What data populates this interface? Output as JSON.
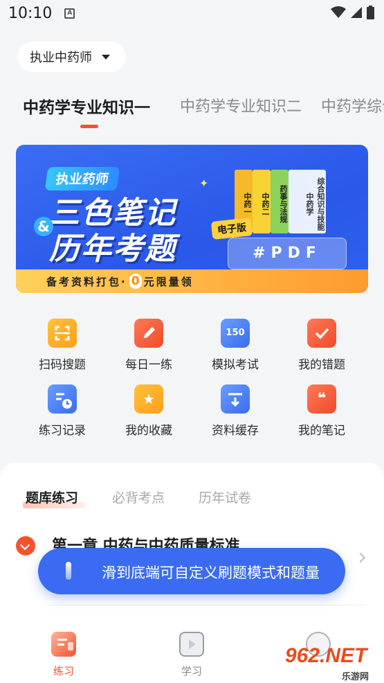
{
  "status_bar": {
    "time": "10:10",
    "notification_letter": "A"
  },
  "cert_selector": {
    "label": "执业中药师"
  },
  "subject_tabs": [
    {
      "label": "中药学专业知识一",
      "active": true
    },
    {
      "label": "中药学专业知识二",
      "active": false
    },
    {
      "label": "中药学综合",
      "active": false
    }
  ],
  "banner": {
    "badge": "执业药师",
    "title_line1": "三色笔记",
    "amp": "&",
    "title_line2": "历年考题",
    "ebook_tag": "电子版",
    "pdf_label": "#PDF",
    "strip_prefix": "备考资料打包·",
    "strip_zero": "0",
    "strip_suffix": "元限量领",
    "books": [
      "中药一",
      "中药二",
      "药事与法规",
      "综合知识与技能 中药学"
    ]
  },
  "grid": {
    "items": [
      {
        "label": "扫码搜题",
        "icon": "scan-icon"
      },
      {
        "label": "每日一练",
        "icon": "daily-icon"
      },
      {
        "label": "模拟考试",
        "icon": "exam-icon",
        "icon_text": "150"
      },
      {
        "label": "我的错题",
        "icon": "mistakes-icon"
      },
      {
        "label": "练习记录",
        "icon": "record-icon"
      },
      {
        "label": "我的收藏",
        "icon": "favorite-icon"
      },
      {
        "label": "资料缓存",
        "icon": "download-icon"
      },
      {
        "label": "我的笔记",
        "icon": "notes-icon"
      }
    ]
  },
  "bank_tabs": [
    {
      "label": "题库练习",
      "active": true
    },
    {
      "label": "必背考点",
      "active": false
    },
    {
      "label": "历年试卷",
      "active": false
    }
  ],
  "chapter": {
    "title": "第一章 中药与中药质量标准"
  },
  "toast": {
    "text": "滑到底端可自定义刷题模式和题量"
  },
  "bottom_nav": [
    {
      "label": "练习",
      "active": true,
      "color": "#f5532d"
    },
    {
      "label": "学习",
      "active": false,
      "color": "#888888"
    }
  ],
  "watermark": {
    "main": "962.NET",
    "sub": "乐游网"
  },
  "colors": {
    "accent": "#f5532d",
    "primary_blue": "#3b6bf2"
  }
}
